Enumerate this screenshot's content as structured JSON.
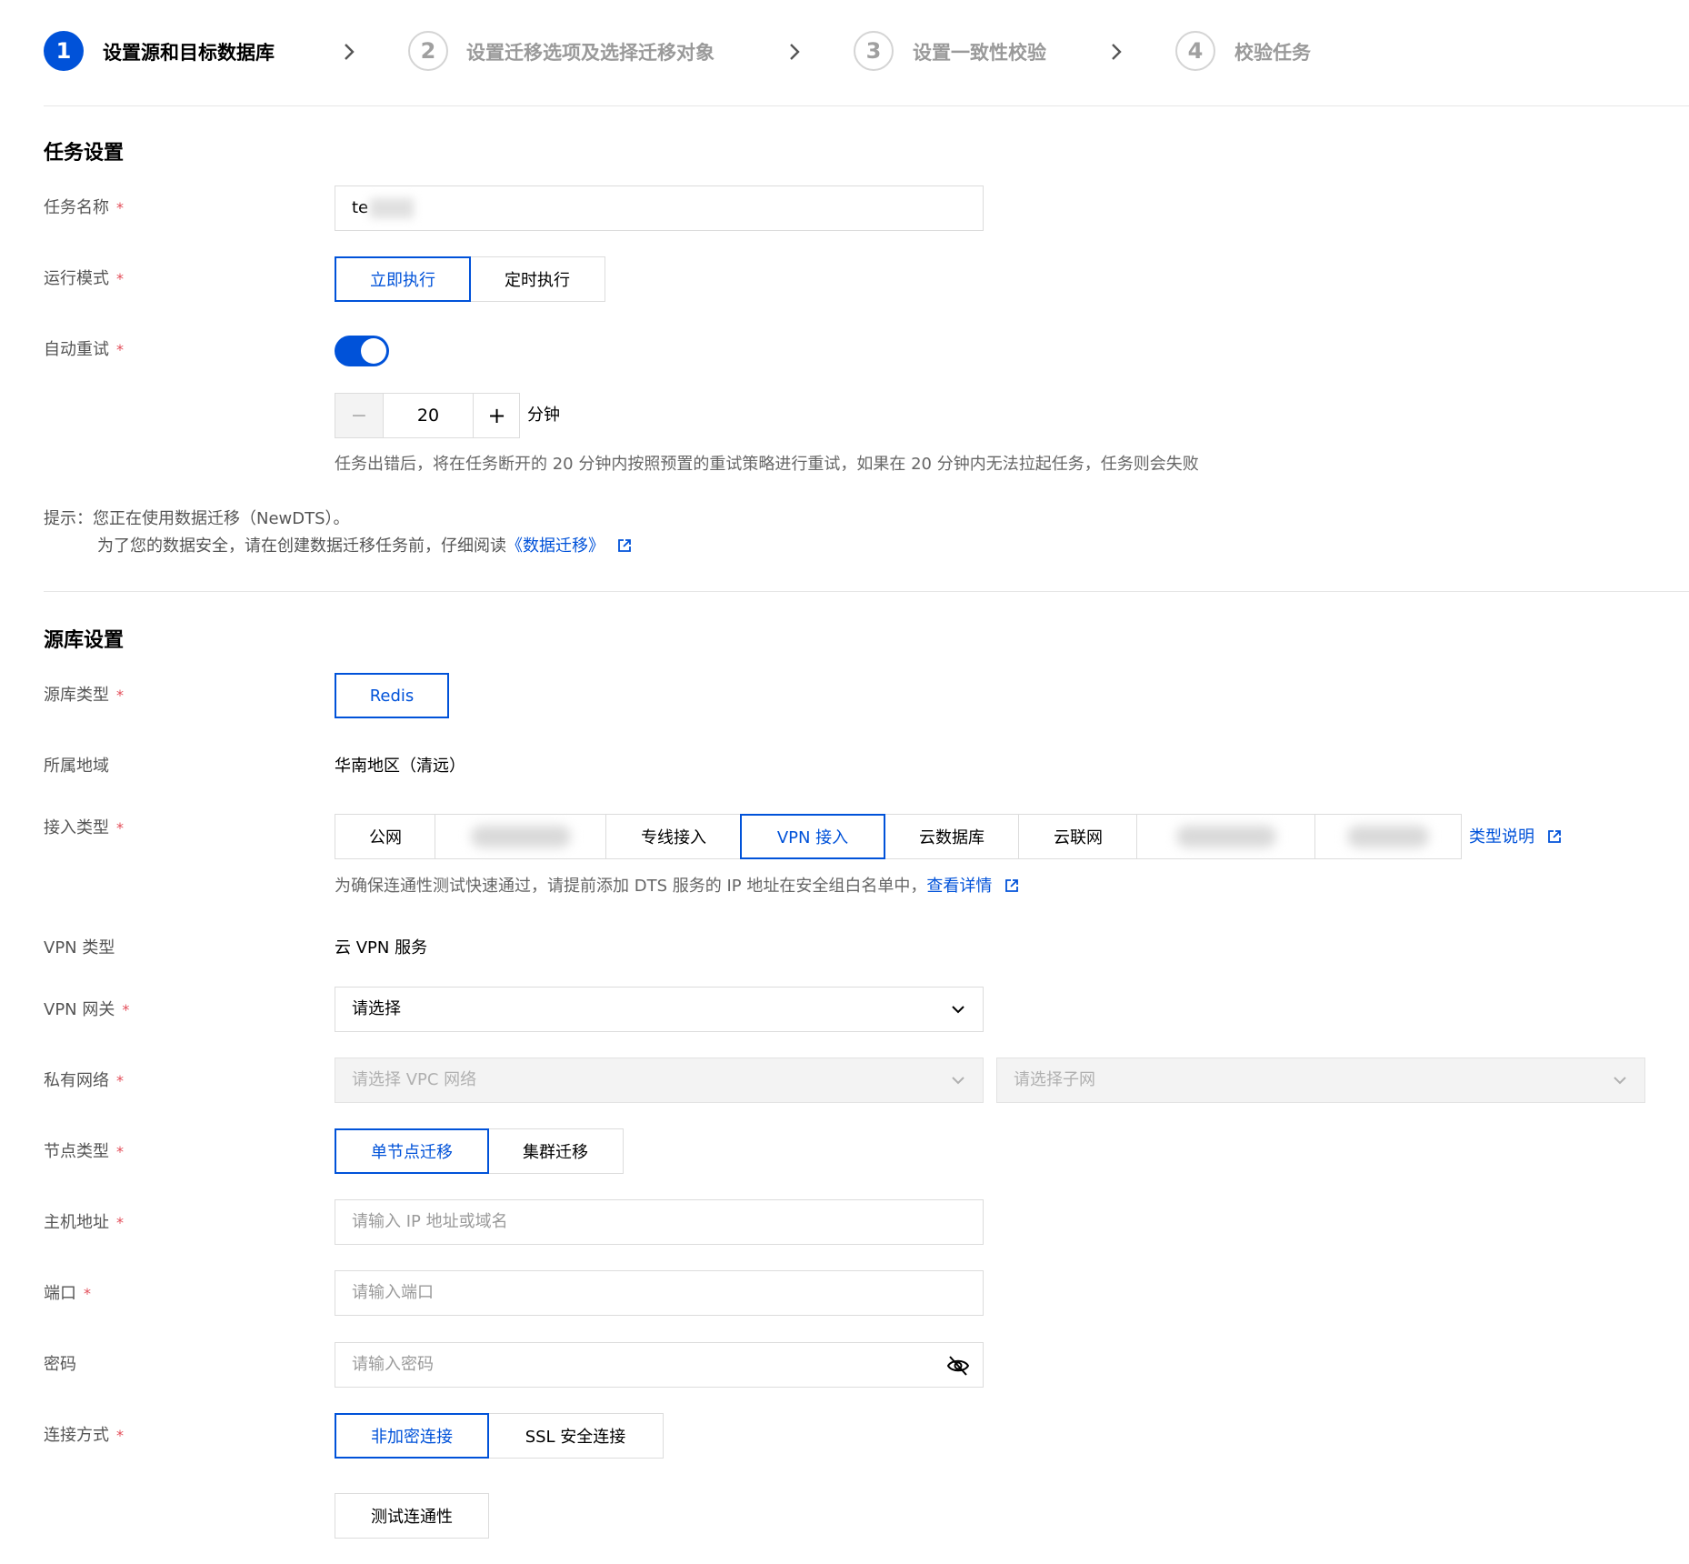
{
  "steps": [
    {
      "num": "1",
      "label": "设置源和目标数据库"
    },
    {
      "num": "2",
      "label": "设置迁移选项及选择迁移对象"
    },
    {
      "num": "3",
      "label": "设置一致性校验"
    },
    {
      "num": "4",
      "label": "校验任务"
    }
  ],
  "task": {
    "section_title": "任务设置",
    "name_label": "任务名称",
    "name_value": "te",
    "mode_label": "运行模式",
    "mode_options": [
      "立即执行",
      "定时执行"
    ],
    "retry_label": "自动重试",
    "retry_minutes": "20",
    "retry_minus": "−",
    "retry_plus": "+",
    "retry_unit": "分钟",
    "retry_hint": "任务出错后，将在任务断开的 20 分钟内按照预置的重试策略进行重试，如果在 20 分钟内无法拉起任务，任务则会失败",
    "tip_line1": "提示：您正在使用数据迁移（NewDTS）。",
    "tip_line2_prefix": "为了您的数据安全，请在创建数据迁移任务前，仔细阅读",
    "tip_link": "《数据迁移》"
  },
  "source": {
    "section_title": "源库设置",
    "type_label": "源库类型",
    "type_value": "Redis",
    "region_label": "所属地域",
    "region_value": "华南地区（清远）",
    "access_label": "接入类型",
    "access_options": [
      "公网",
      "",
      "专线接入",
      "VPN 接入",
      "云数据库",
      "云联网",
      "",
      ""
    ],
    "access_help_link": "类型说明",
    "access_hint_prefix": "为确保连通性测试快速通过，请提前添加 DTS 服务的 IP 地址在安全组白名单中，",
    "access_hint_link": "查看详情",
    "vpn_type_label": "VPN 类型",
    "vpn_type_value": "云 VPN 服务",
    "vpn_gateway_label": "VPN 网关",
    "vpn_gateway_value": "请选择",
    "vpc_label": "私有网络",
    "vpc_placeholder": "请选择 VPC 网络",
    "subnet_placeholder": "请选择子网",
    "node_label": "节点类型",
    "node_options": [
      "单节点迁移",
      "集群迁移"
    ],
    "host_label": "主机地址",
    "host_placeholder": "请输入 IP 地址或域名",
    "port_label": "端口",
    "port_placeholder": "请输入端口",
    "password_label": "密码",
    "password_placeholder": "请输入密码",
    "conn_label": "连接方式",
    "conn_options": [
      "非加密连接",
      "SSL 安全连接"
    ],
    "test_button": "测试连通性"
  },
  "required_mark": "*",
  "colors": {
    "primary": "#0052d9",
    "required": "#e34d59",
    "switch_on": "#0052d9"
  }
}
